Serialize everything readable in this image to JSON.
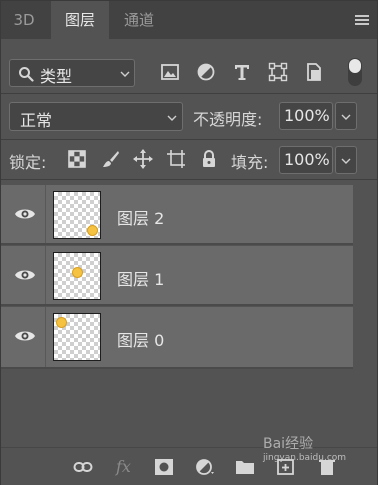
{
  "tabs": [
    {
      "label": "3D",
      "active": false
    },
    {
      "label": "图层",
      "active": true
    },
    {
      "label": "通道",
      "active": false
    }
  ],
  "filter": {
    "value": "类型",
    "icons": [
      "image-icon",
      "adjustment-icon",
      "type-icon",
      "shape-icon",
      "smart-object-icon"
    ]
  },
  "blend": {
    "mode": "正常",
    "opacity_label": "不透明度:",
    "opacity_value": "100%"
  },
  "lock": {
    "label": "锁定:",
    "fill_label": "填充:",
    "fill_value": "100%",
    "icons": [
      "lock-transparent-icon",
      "lock-image-icon",
      "lock-position-icon",
      "lock-artboard-icon",
      "lock-all-icon"
    ]
  },
  "layers": [
    {
      "name": "图层 2",
      "visible": true
    },
    {
      "name": "图层 1",
      "visible": true
    },
    {
      "name": "图层 0",
      "visible": true
    }
  ],
  "bottom": {
    "fx_label": "fx",
    "icons": [
      "link-icon",
      "fx-icon",
      "mask-icon",
      "adjustment-layer-icon",
      "folder-icon",
      "new-layer-icon",
      "trash-icon"
    ]
  },
  "watermark": {
    "text": "Bai经验",
    "sub": "jingyan.baidu.com"
  },
  "colors": {
    "panel": "#535353",
    "tabbar": "#424242",
    "layer_row": "#6a6a6a",
    "text": "#e6e6e6"
  }
}
